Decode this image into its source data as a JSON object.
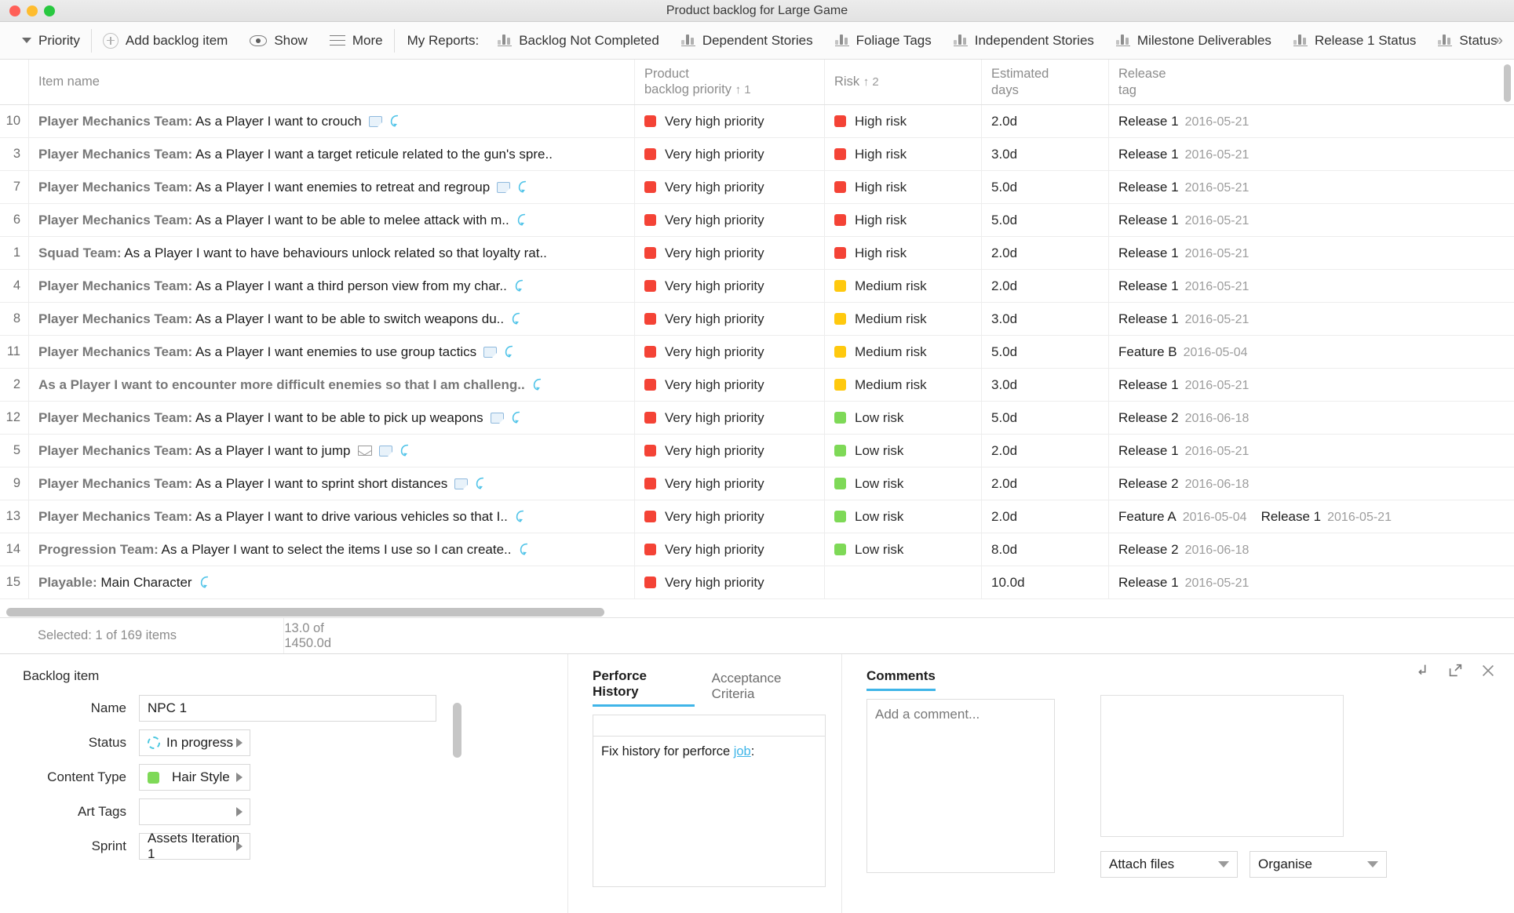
{
  "window": {
    "title": "Product backlog for Large Game",
    "controls": [
      "close",
      "minimize",
      "maximize"
    ]
  },
  "toolbar": {
    "priority_label": "Priority",
    "add_label": "Add backlog item",
    "show_label": "Show",
    "more_label": "More",
    "my_reports_label": "My Reports:",
    "reports": [
      "Backlog Not Completed",
      "Dependent Stories",
      "Foliage Tags",
      "Independent Stories",
      "Milestone Deliverables",
      "Release 1 Status",
      "Status"
    ],
    "overflow": "»"
  },
  "table": {
    "columns": [
      {
        "key": "num",
        "label": ""
      },
      {
        "key": "name",
        "label": "Item name"
      },
      {
        "key": "prio",
        "label": "Product\nbacklog priority",
        "sort": "↑ 1"
      },
      {
        "key": "risk",
        "label": "Risk",
        "sort": "↑ 2"
      },
      {
        "key": "days",
        "label": "Estimated\ndays"
      },
      {
        "key": "rel",
        "label": "Release\ntag"
      }
    ],
    "header": {
      "item_name": "Item name",
      "priority_l1": "Product",
      "priority_l2": "backlog priority",
      "priority_sort": "↑ 1",
      "risk": "Risk",
      "risk_sort": "↑ 2",
      "days_l1": "Estimated",
      "days_l2": "days",
      "rel_l1": "Release",
      "rel_l2": "tag"
    },
    "rows": [
      {
        "num": "10",
        "team": "Player Mechanics Team:",
        "story": " As a Player I want to crouch",
        "icons": [
          "note-icon",
          "refresh-icon"
        ],
        "priority": "Very high priority",
        "priority_color": "#F44336",
        "risk": "High risk",
        "risk_color": "#F44336",
        "days": "2.0d",
        "tags": [
          {
            "name": "Release 1",
            "date": "2016-05-21"
          }
        ]
      },
      {
        "num": "3",
        "team": "Player Mechanics Team:",
        "story": " As a Player I want a target reticule related to the gun's spre..",
        "icons": [],
        "priority": "Very high priority",
        "priority_color": "#F44336",
        "risk": "High risk",
        "risk_color": "#F44336",
        "days": "3.0d",
        "tags": [
          {
            "name": "Release 1",
            "date": "2016-05-21"
          }
        ]
      },
      {
        "num": "7",
        "team": "Player Mechanics Team:",
        "story": " As a Player I want enemies to retreat and regroup",
        "icons": [
          "note-icon",
          "refresh-icon"
        ],
        "priority": "Very high priority",
        "priority_color": "#F44336",
        "risk": "High risk",
        "risk_color": "#F44336",
        "days": "5.0d",
        "tags": [
          {
            "name": "Release 1",
            "date": "2016-05-21"
          }
        ]
      },
      {
        "num": "6",
        "team": "Player Mechanics Team:",
        "story": " As a Player I want to be able to melee attack with m..",
        "icons": [
          "refresh-icon"
        ],
        "priority": "Very high priority",
        "priority_color": "#F44336",
        "risk": "High risk",
        "risk_color": "#F44336",
        "days": "5.0d",
        "tags": [
          {
            "name": "Release 1",
            "date": "2016-05-21"
          }
        ]
      },
      {
        "num": "1",
        "team": "Squad Team:",
        "story": " As a Player I want to have behaviours unlock related so that loyalty rat..",
        "icons": [],
        "priority": "Very high priority",
        "priority_color": "#F44336",
        "risk": "High risk",
        "risk_color": "#F44336",
        "days": "2.0d",
        "tags": [
          {
            "name": "Release 1",
            "date": "2016-05-21"
          }
        ]
      },
      {
        "num": "4",
        "team": "Player Mechanics Team:",
        "story": " As a Player I want a third person view from my char..",
        "icons": [
          "refresh-icon"
        ],
        "priority": "Very high priority",
        "priority_color": "#F44336",
        "risk": "Medium risk",
        "risk_color": "#FFC90E",
        "days": "2.0d",
        "tags": [
          {
            "name": "Release 1",
            "date": "2016-05-21"
          }
        ]
      },
      {
        "num": "8",
        "team": "Player Mechanics Team:",
        "story": " As a Player I want to be able to switch weapons du..",
        "icons": [
          "refresh-icon"
        ],
        "priority": "Very high priority",
        "priority_color": "#F44336",
        "risk": "Medium risk",
        "risk_color": "#FFC90E",
        "days": "3.0d",
        "tags": [
          {
            "name": "Release 1",
            "date": "2016-05-21"
          }
        ]
      },
      {
        "num": "11",
        "team": "Player Mechanics Team:",
        "story": " As a Player I want enemies to use group tactics",
        "icons": [
          "note-icon",
          "refresh-icon"
        ],
        "priority": "Very high priority",
        "priority_color": "#F44336",
        "risk": "Medium risk",
        "risk_color": "#FFC90E",
        "days": "5.0d",
        "tags": [
          {
            "name": "Feature B",
            "date": "2016-05-04"
          }
        ]
      },
      {
        "num": "2",
        "team": "As a Player I want to encounter more difficult enemies so that I am challeng..",
        "story": "",
        "icons": [
          "refresh-icon"
        ],
        "priority": "Very high priority",
        "priority_color": "#F44336",
        "risk": "Medium risk",
        "risk_color": "#FFC90E",
        "days": "3.0d",
        "tags": [
          {
            "name": "Release 1",
            "date": "2016-05-21"
          }
        ]
      },
      {
        "num": "12",
        "team": "Player Mechanics Team:",
        "story": " As a Player I want to be able to pick up weapons",
        "icons": [
          "note-icon",
          "refresh-icon"
        ],
        "priority": "Very high priority",
        "priority_color": "#F44336",
        "risk": "Low risk",
        "risk_color": "#7ED957",
        "days": "5.0d",
        "tags": [
          {
            "name": "Release 2",
            "date": "2016-06-18"
          }
        ]
      },
      {
        "num": "5",
        "team": "Player Mechanics Team:",
        "story": " As a Player I want to jump",
        "icons": [
          "mail-icon",
          "note-icon",
          "refresh-icon"
        ],
        "priority": "Very high priority",
        "priority_color": "#F44336",
        "risk": "Low risk",
        "risk_color": "#7ED957",
        "days": "2.0d",
        "tags": [
          {
            "name": "Release 1",
            "date": "2016-05-21"
          }
        ]
      },
      {
        "num": "9",
        "team": "Player Mechanics Team:",
        "story": " As a Player I want to sprint short distances",
        "icons": [
          "note-icon",
          "refresh-icon"
        ],
        "priority": "Very high priority",
        "priority_color": "#F44336",
        "risk": "Low risk",
        "risk_color": "#7ED957",
        "days": "2.0d",
        "tags": [
          {
            "name": "Release 2",
            "date": "2016-06-18"
          }
        ]
      },
      {
        "num": "13",
        "team": "Player Mechanics Team:",
        "story": " As a Player I want to drive various vehicles so that I..",
        "icons": [
          "refresh-icon"
        ],
        "priority": "Very high priority",
        "priority_color": "#F44336",
        "risk": "Low risk",
        "risk_color": "#7ED957",
        "days": "2.0d",
        "tags": [
          {
            "name": "Feature A",
            "date": "2016-05-04"
          },
          {
            "name": "Release 1",
            "date": "2016-05-21"
          }
        ]
      },
      {
        "num": "14",
        "team": "Progression Team:",
        "story": " As a Player I want to select the items I use so I can create..",
        "icons": [
          "refresh-icon"
        ],
        "priority": "Very high priority",
        "priority_color": "#F44336",
        "risk": "Low risk",
        "risk_color": "#7ED957",
        "days": "8.0d",
        "tags": [
          {
            "name": "Release 2",
            "date": "2016-06-18"
          }
        ]
      },
      {
        "num": "15",
        "team": "Playable:",
        "story": " Main Character",
        "icons": [
          "refresh-icon"
        ],
        "priority": "Very high priority",
        "priority_color": "#F44336",
        "risk": "",
        "risk_color": "",
        "days": "10.0d",
        "tags": [
          {
            "name": "Release 1",
            "date": "2016-05-21"
          }
        ]
      }
    ]
  },
  "status": {
    "selected": "Selected: 1 of 169 items",
    "totals": "13.0 of 1450.0d"
  },
  "detail": {
    "form": {
      "title": "Backlog item",
      "fields": [
        {
          "label": "Name",
          "value": "NPC 1",
          "type": "text"
        },
        {
          "label": "Status",
          "value": "In progress",
          "type": "select",
          "icon": "spinner-icon"
        },
        {
          "label": "Content Type",
          "value": "Hair Style",
          "type": "select",
          "swatch": "#7ED957"
        },
        {
          "label": "Art Tags",
          "value": "",
          "type": "select"
        },
        {
          "label": "Sprint",
          "value": "Assets Iteration 1",
          "type": "select"
        }
      ]
    },
    "history": {
      "tabs": [
        {
          "label": "Perforce History",
          "active": true
        },
        {
          "label": "Acceptance Criteria",
          "active": false
        }
      ],
      "body_prefix": "Fix history for perforce ",
      "body_link": "job",
      "body_suffix": ":"
    },
    "comments": {
      "title": "Comments",
      "placeholder": "Add a comment..."
    },
    "right": {
      "icons": [
        "popout-icon",
        "expand-icon",
        "close-icon"
      ],
      "attach_label": "Attach files",
      "organise_label": "Organise"
    }
  }
}
